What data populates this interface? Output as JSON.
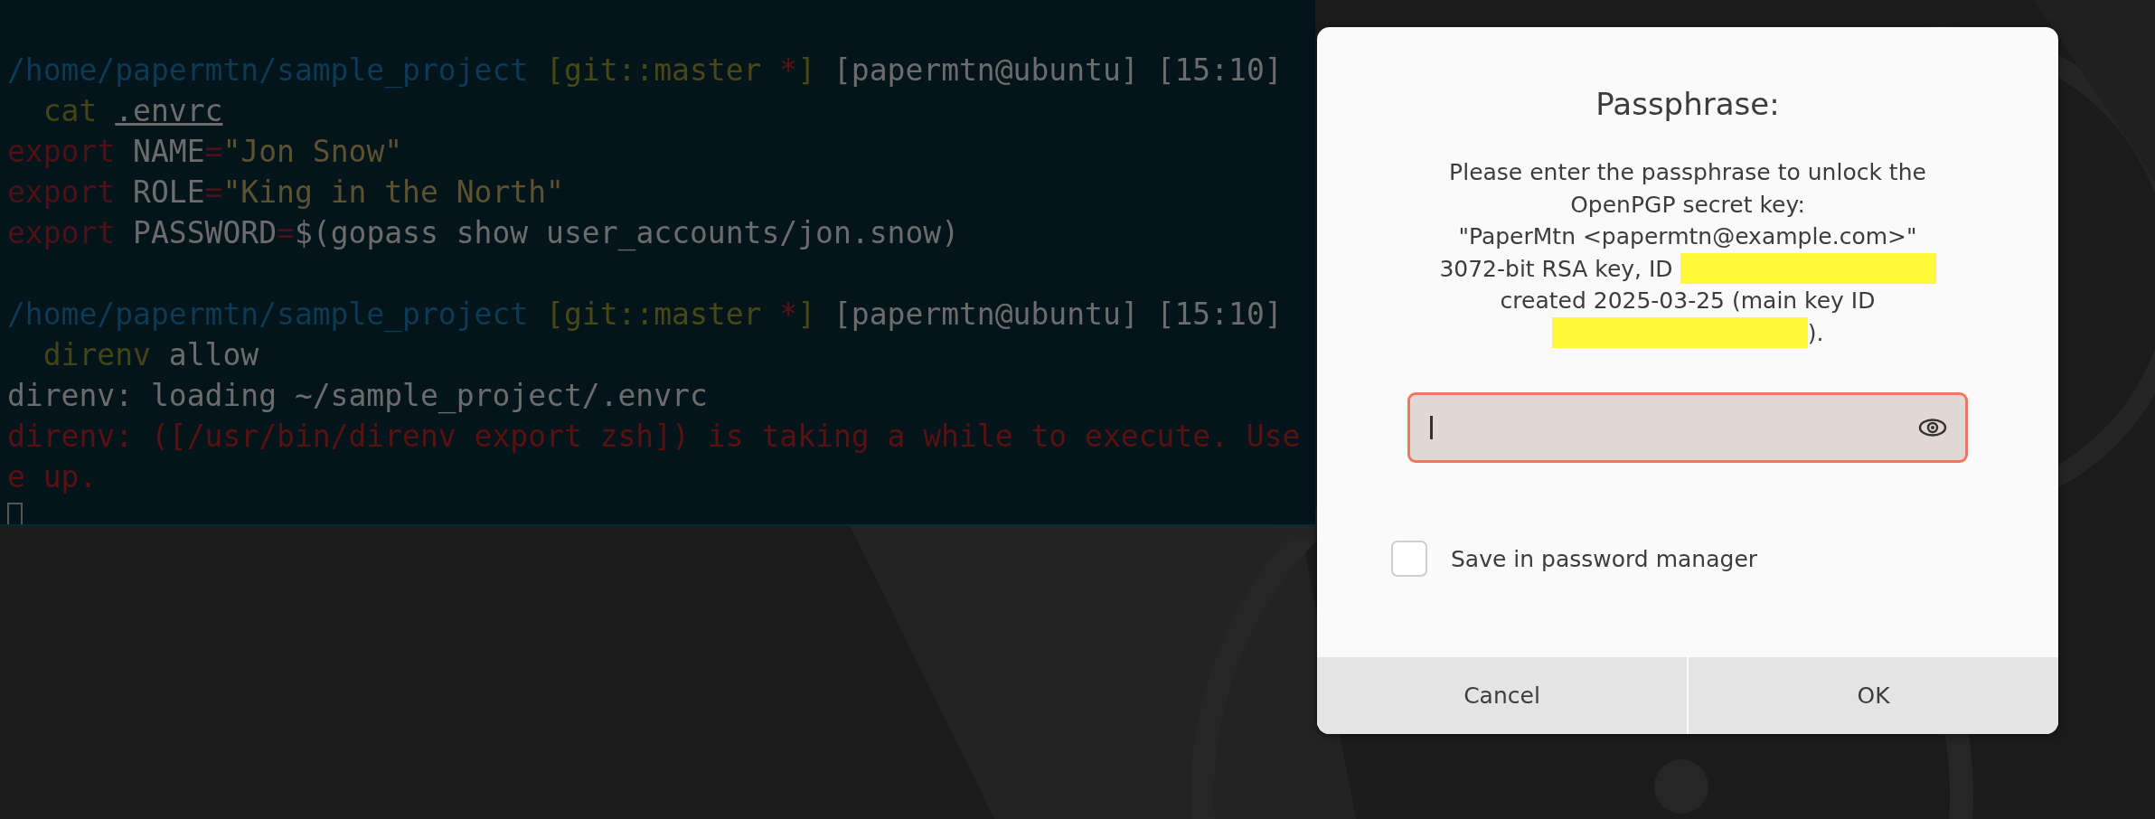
{
  "terminal": {
    "lines": [
      [
        {
          "kind": "path",
          "text": "/home/papermtn/sample_project "
        },
        {
          "kind": "git",
          "text": "[git::master "
        },
        {
          "kind": "dirty",
          "text": "*"
        },
        {
          "kind": "git",
          "text": "]"
        },
        {
          "kind": "plain",
          "text": " [papermtn@ubuntu] [15:10]"
        }
      ],
      [
        {
          "kind": "command",
          "text": "  cat "
        },
        {
          "kind": "file",
          "text": ".envrc"
        }
      ],
      [
        {
          "kind": "keyword",
          "text": "export"
        },
        {
          "kind": "plain",
          "text": " NAME"
        },
        {
          "kind": "keyword",
          "text": "="
        },
        {
          "kind": "string",
          "text": "\"Jon Snow\""
        }
      ],
      [
        {
          "kind": "keyword",
          "text": "export"
        },
        {
          "kind": "plain",
          "text": " ROLE"
        },
        {
          "kind": "keyword",
          "text": "="
        },
        {
          "kind": "string",
          "text": "\"King in the North\""
        }
      ],
      [
        {
          "kind": "keyword",
          "text": "export"
        },
        {
          "kind": "plain",
          "text": " PASSWORD"
        },
        {
          "kind": "keyword",
          "text": "="
        },
        {
          "kind": "plain",
          "text": "$(gopass show user_accounts/jon.snow)"
        }
      ],
      {
        "kind": "blank"
      },
      [
        {
          "kind": "path",
          "text": "/home/papermtn/sample_project "
        },
        {
          "kind": "git",
          "text": "[git::master "
        },
        {
          "kind": "dirty",
          "text": "*"
        },
        {
          "kind": "git",
          "text": "]"
        },
        {
          "kind": "plain",
          "text": " [papermtn@ubuntu] [15:10]"
        }
      ],
      [
        {
          "kind": "command",
          "text": "  direnv"
        },
        {
          "kind": "plain",
          "text": " allow"
        }
      ],
      [
        {
          "kind": "plain",
          "text": "direnv: loading ~/sample_project/.envrc"
        }
      ],
      [
        {
          "kind": "error",
          "text": "direnv: ([/usr/bin/direnv export zsh]) is taking a while to execute. Use"
        }
      ],
      [
        {
          "kind": "error",
          "text": "e up."
        }
      ]
    ]
  },
  "dialog": {
    "title": "Passphrase:",
    "message": [
      [
        {
          "kind": "text",
          "text": "Please enter the passphrase to unlock the"
        }
      ],
      [
        {
          "kind": "text",
          "text": "OpenPGP secret key:"
        }
      ],
      [
        {
          "kind": "text",
          "text": "\"PaperMtn <papermtn@example.com>\""
        }
      ],
      [
        {
          "kind": "text",
          "text": "3072-bit RSA key, ID"
        },
        {
          "kind": "redaction"
        }
      ],
      [
        {
          "kind": "text",
          "text": "created 2025-03-25 (main key ID"
        }
      ],
      [
        {
          "kind": "redaction"
        },
        {
          "kind": "text",
          "text": ")."
        }
      ]
    ],
    "save_in_manager": {
      "label": "Save in password manager",
      "checked": false
    },
    "buttons": [
      {
        "label": "Cancel"
      },
      {
        "label": "OK"
      }
    ]
  }
}
